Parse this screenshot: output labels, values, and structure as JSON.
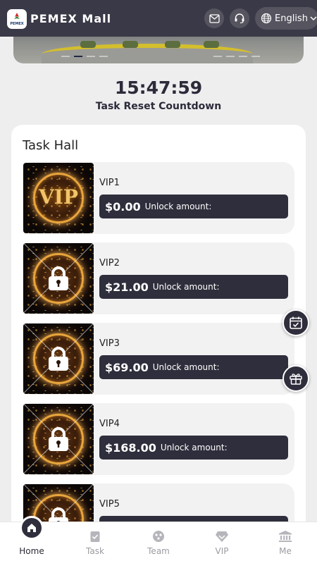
{
  "header": {
    "brand": "PEMEX Mall",
    "logo_text": "PEMEX",
    "mail_icon": "mail-icon",
    "support_icon": "headset-icon",
    "language": "English"
  },
  "banner": {
    "slide_count": 10,
    "active_slide": 2
  },
  "countdown": {
    "time": "15:47:59",
    "label": "Task Reset Countdown"
  },
  "task_hall": {
    "title": "Task Hall",
    "unlock_label": "Unlock amount:",
    "levels": [
      {
        "name": "VIP1",
        "price": "$0.00",
        "locked": false
      },
      {
        "name": "VIP2",
        "price": "$21.00",
        "locked": true
      },
      {
        "name": "VIP3",
        "price": "$69.00",
        "locked": true
      },
      {
        "name": "VIP4",
        "price": "$168.00",
        "locked": true
      },
      {
        "name": "VIP5",
        "price": "",
        "locked": true
      }
    ]
  },
  "floating": {
    "calendar_icon": "calendar-check-icon",
    "gift_icon": "gift-icon"
  },
  "nav": {
    "items": [
      {
        "label": "Home",
        "icon": "home-icon",
        "active": true
      },
      {
        "label": "Task",
        "icon": "task-icon",
        "active": false
      },
      {
        "label": "Team",
        "icon": "team-icon",
        "active": false
      },
      {
        "label": "VIP",
        "icon": "vip-diamond-icon",
        "active": false
      },
      {
        "label": "Me",
        "icon": "bank-icon",
        "active": false
      }
    ]
  },
  "colors": {
    "header_bg": "#3a3947",
    "dark_accent": "#2f2e3c",
    "page_bg": "#eeeeef",
    "nav_inactive": "#9b9ba2"
  }
}
